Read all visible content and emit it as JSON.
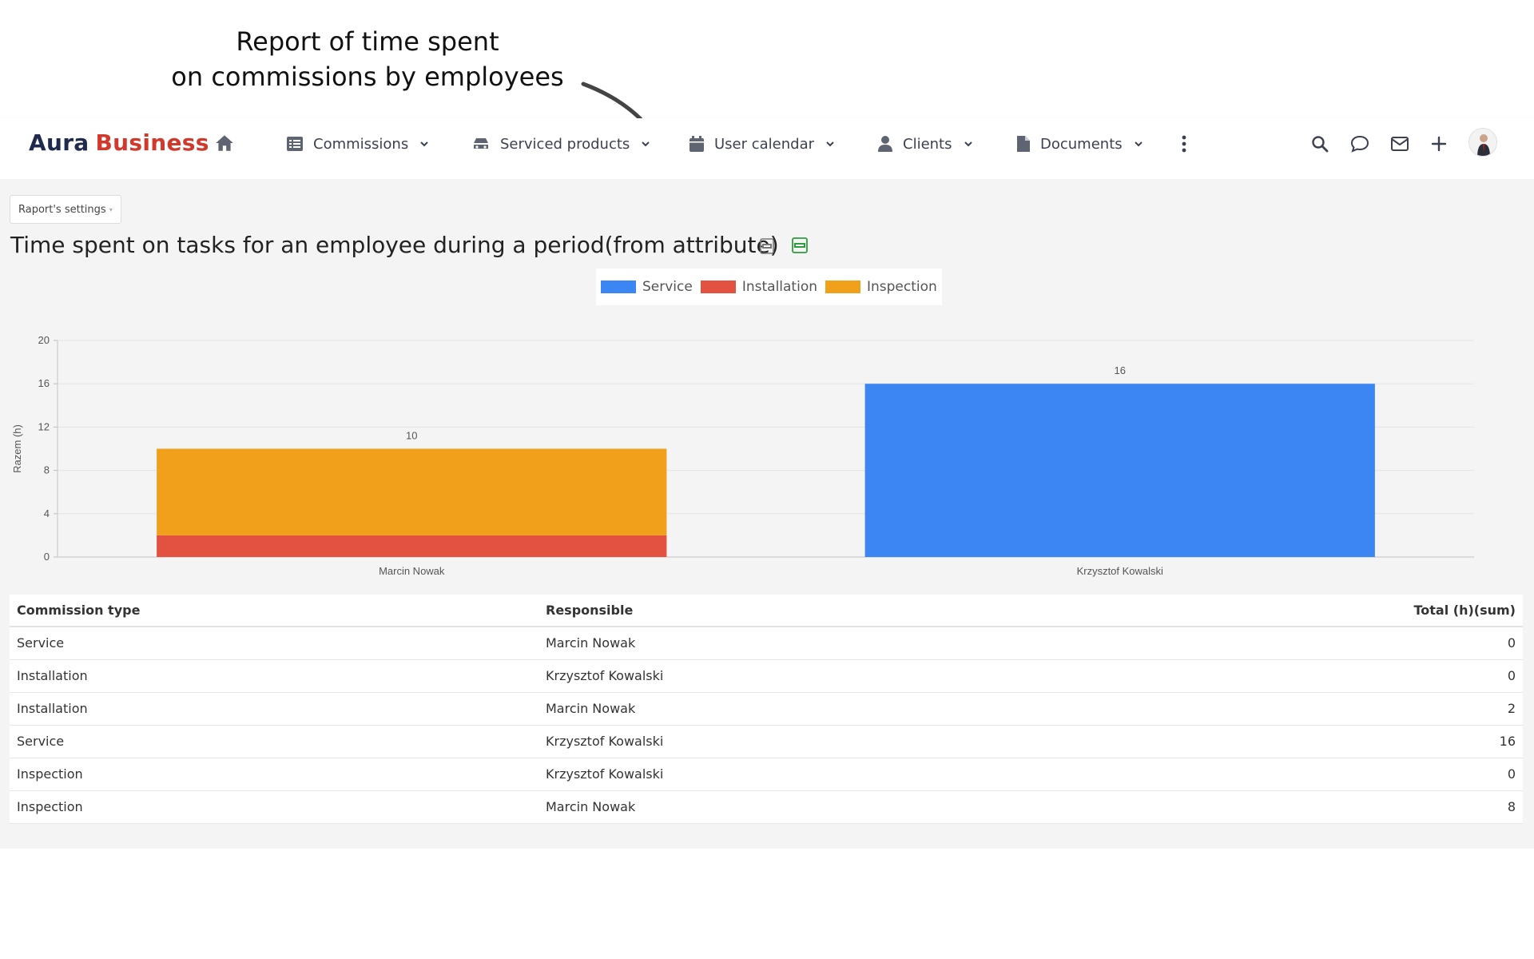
{
  "annotation": {
    "line1": "Report of time spent",
    "line2": "on commissions by employees"
  },
  "navbar": {
    "logo_part1": "Aura",
    "logo_part2": "Business",
    "items": [
      {
        "label": "Commissions",
        "icon": "list-icon"
      },
      {
        "label": "Serviced products",
        "icon": "car-icon"
      },
      {
        "label": "User calendar",
        "icon": "calendar-icon"
      },
      {
        "label": "Clients",
        "icon": "user-icon"
      },
      {
        "label": "Documents",
        "icon": "file-icon"
      }
    ],
    "right_icons": [
      "search-icon",
      "chat-icon",
      "mail-icon",
      "plus-icon",
      "avatar"
    ]
  },
  "report": {
    "settings_label": "Raport's settings",
    "title": "Time spent on tasks for an employee during a period(from attribute)"
  },
  "colors": {
    "service": "#3b86f2",
    "installation": "#e35140",
    "inspection": "#f0a01a",
    "logo_dark": "#1f2a4d",
    "logo_red": "#d0392b"
  },
  "chart_data": {
    "type": "bar",
    "stacked": true,
    "categories": [
      "Marcin Nowak",
      "Krzysztof Kowalski"
    ],
    "series": [
      {
        "name": "Service",
        "values": [
          0,
          16
        ]
      },
      {
        "name": "Installation",
        "values": [
          2,
          0
        ]
      },
      {
        "name": "Inspection",
        "values": [
          8,
          0
        ]
      }
    ],
    "totals": [
      10,
      16
    ],
    "ylabel": "Razem (h)",
    "ylim": [
      0,
      20
    ],
    "yticks": [
      0,
      4,
      8,
      12,
      16,
      20
    ],
    "grid": true,
    "legend": "top-center"
  },
  "table": {
    "headers": [
      "Commission type",
      "Responsible",
      "Total (h)(sum)"
    ],
    "rows": [
      [
        "Service",
        "Marcin Nowak",
        "0"
      ],
      [
        "Installation",
        "Krzysztof Kowalski",
        "0"
      ],
      [
        "Installation",
        "Marcin Nowak",
        "2"
      ],
      [
        "Service",
        "Krzysztof Kowalski",
        "16"
      ],
      [
        "Inspection",
        "Krzysztof Kowalski",
        "0"
      ],
      [
        "Inspection",
        "Marcin Nowak",
        "8"
      ]
    ]
  }
}
